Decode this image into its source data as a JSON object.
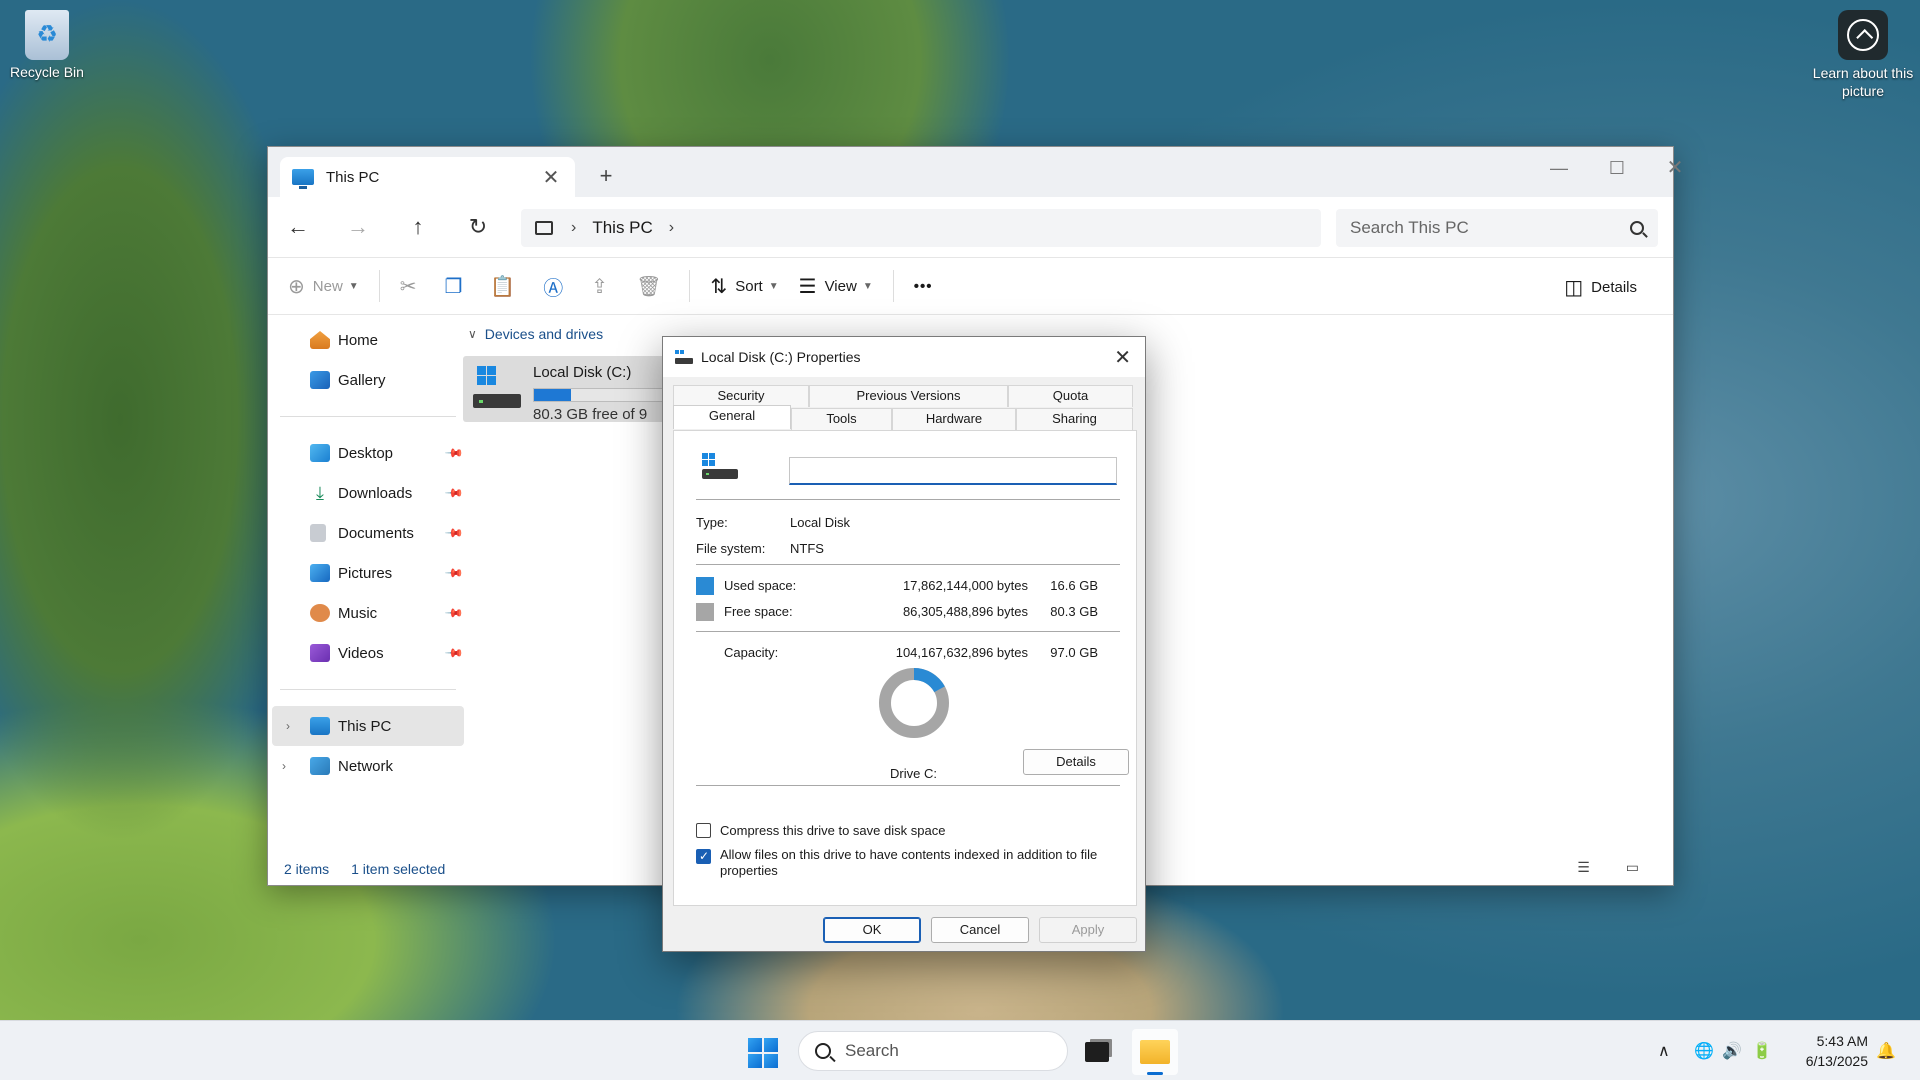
{
  "desktop": {
    "icons": [
      {
        "label": "Recycle Bin"
      },
      {
        "label": "Learn about this picture"
      }
    ]
  },
  "explorer": {
    "tab_title": "This PC",
    "address": {
      "segments": [
        "This PC"
      ]
    },
    "search_placeholder": "Search This PC",
    "toolbar": {
      "new_label": "New",
      "sort_label": "Sort",
      "view_label": "View",
      "more_label": "•••",
      "details_label": "Details"
    },
    "sidebar": {
      "top": [
        {
          "label": "Home",
          "icon": "home-icon"
        },
        {
          "label": "Gallery",
          "icon": "gallery-icon"
        }
      ],
      "quick_access": [
        {
          "label": "Desktop",
          "icon": "desktop-icon"
        },
        {
          "label": "Downloads",
          "icon": "downloads-icon"
        },
        {
          "label": "Documents",
          "icon": "documents-icon"
        },
        {
          "label": "Pictures",
          "icon": "pictures-icon"
        },
        {
          "label": "Music",
          "icon": "music-icon"
        },
        {
          "label": "Videos",
          "icon": "videos-icon"
        }
      ],
      "locations": [
        {
          "label": "This PC",
          "icon": "this-pc-icon",
          "selected": true
        },
        {
          "label": "Network",
          "icon": "network-icon",
          "selected": false
        }
      ]
    },
    "group_header": "Devices and drives",
    "drive": {
      "name": "Local Disk (C:)",
      "free_text": "80.3 GB free of 9",
      "used_fraction": 0.171
    },
    "status": {
      "items": "2 items",
      "selected": "1 item selected"
    }
  },
  "dialog": {
    "title": "Local Disk (C:) Properties",
    "tabs_row1": [
      "Security",
      "Previous Versions",
      "Quota"
    ],
    "tabs_row2": [
      "General",
      "Tools",
      "Hardware",
      "Sharing"
    ],
    "active_tab": "General",
    "name_value": "",
    "type_label": "Type:",
    "type_value": "Local Disk",
    "fs_label": "File system:",
    "fs_value": "NTFS",
    "used_label": "Used space:",
    "used_bytes": "17,862,144,000 bytes",
    "used_gb": "16.6 GB",
    "free_label": "Free space:",
    "free_bytes": "86,305,488,896 bytes",
    "free_gb": "80.3 GB",
    "capacity_label": "Capacity:",
    "capacity_bytes": "104,167,632,896 bytes",
    "capacity_gb": "97.0 GB",
    "drive_label": "Drive C:",
    "details_button": "Details",
    "compress_label": "Compress this drive to save disk space",
    "compress_checked": false,
    "index_label_line1": "Allow files on this drive to have contents indexed in addition to file",
    "index_label_line2": "properties",
    "index_checked": true,
    "ok": "OK",
    "cancel": "Cancel",
    "apply": "Apply",
    "colors": {
      "used": "#2a8ad4",
      "free": "#a6a6a6"
    }
  },
  "taskbar": {
    "search_placeholder": "Search",
    "time": "5:43 AM",
    "date": "6/13/2025"
  }
}
